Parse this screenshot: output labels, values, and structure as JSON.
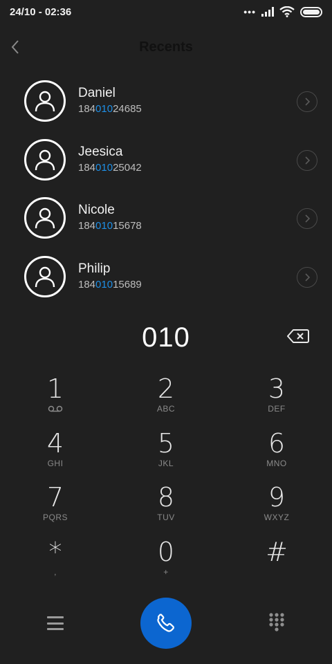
{
  "status_bar": {
    "time": "24/10 - 02:36",
    "signal_dots": "•••"
  },
  "header": {
    "title": "Recents"
  },
  "recents": [
    {
      "name": "Daniel",
      "number_prefix": "184",
      "number_match": "010",
      "number_suffix": "24685"
    },
    {
      "name": "Jeesica",
      "number_prefix": "184",
      "number_match": "010",
      "number_suffix": "25042"
    },
    {
      "name": "Nicole",
      "number_prefix": "184",
      "number_match": "010",
      "number_suffix": "15678"
    },
    {
      "name": "Philip",
      "number_prefix": "184",
      "number_match": "010",
      "number_suffix": "15689"
    }
  ],
  "dial": {
    "input": "010"
  },
  "keypad": [
    {
      "digit": "1",
      "letters": ""
    },
    {
      "digit": "2",
      "letters": "ABC"
    },
    {
      "digit": "3",
      "letters": "DEF"
    },
    {
      "digit": "4",
      "letters": "GHI"
    },
    {
      "digit": "5",
      "letters": "JKL"
    },
    {
      "digit": "6",
      "letters": "MNO"
    },
    {
      "digit": "7",
      "letters": "PQRS"
    },
    {
      "digit": "8",
      "letters": "TUV"
    },
    {
      "digit": "9",
      "letters": "WXYZ"
    },
    {
      "digit": "*",
      "letters": ","
    },
    {
      "digit": "0",
      "letters": "+"
    },
    {
      "digit": "#",
      "letters": ""
    }
  ],
  "colors": {
    "background": "#202020",
    "highlight": "#1e8fe6",
    "call_button": "#0c66d0"
  },
  "icons": {
    "back": "chevron-left-icon",
    "avatar": "person-icon",
    "detail": "chevron-right-circle-icon",
    "backspace": "backspace-icon",
    "voicemail": "voicemail-icon",
    "menu": "hamburger-menu-icon",
    "call": "phone-icon",
    "keypad": "dialpad-icon",
    "wifi": "wifi-icon",
    "signal": "signal-icon",
    "battery": "battery-icon"
  }
}
